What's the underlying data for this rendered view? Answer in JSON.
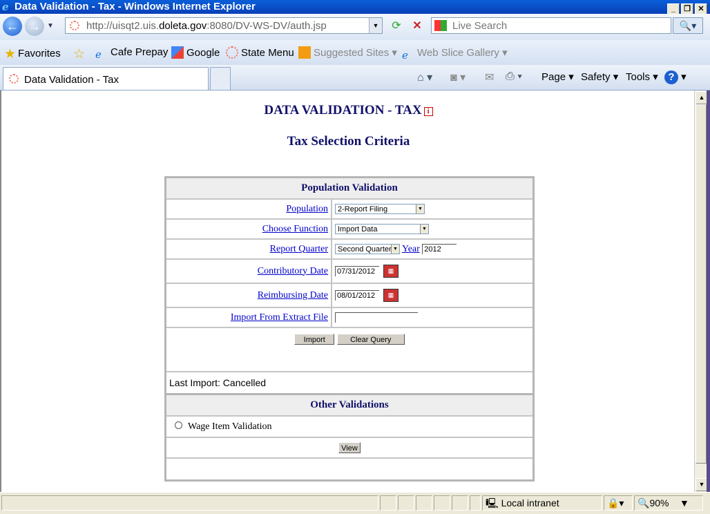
{
  "window": {
    "title": "Data Validation - Tax - Windows Internet Explorer"
  },
  "address": {
    "url_prefix": "http://uisqt2.uis.",
    "url_domain": "doleta.gov",
    "url_suffix": ":8080/DV-WS-DV/auth.jsp"
  },
  "search": {
    "placeholder": "Live Search"
  },
  "favorites": {
    "label": "Favorites",
    "items": [
      "Cafe Prepay",
      "Google",
      "State Menu",
      "Suggested Sites",
      "Web Slice Gallery"
    ]
  },
  "tab": {
    "title": "Data Validation - Tax"
  },
  "command_bar": {
    "page": "Page",
    "safety": "Safety",
    "tools": "Tools"
  },
  "page": {
    "title": "DATA VALIDATION - TAX",
    "subtitle": "Tax Selection Criteria",
    "population_section": {
      "header": "Population Validation",
      "population_label": "Population",
      "population_value": "2-Report Filing",
      "function_label": "Choose Function",
      "function_value": "Import Data",
      "quarter_label": "Report Quarter",
      "quarter_value": "Second Quarter",
      "year_label": "Year",
      "year_value": "2012",
      "contributory_label": "Contributory Date",
      "contributory_value": "07/31/2012",
      "reimbursing_label": "Reimbursing Date",
      "reimbursing_value": "08/01/2012",
      "import_file_label": "Import From Extract File",
      "import_button": "Import",
      "clear_button": "Clear Query",
      "last_import": "Last Import: Cancelled"
    },
    "other_section": {
      "header": "Other Validations",
      "option": "Wage Item Validation",
      "view_button": "View"
    }
  },
  "status": {
    "zone": "Local intranet",
    "zoom": "90%"
  }
}
